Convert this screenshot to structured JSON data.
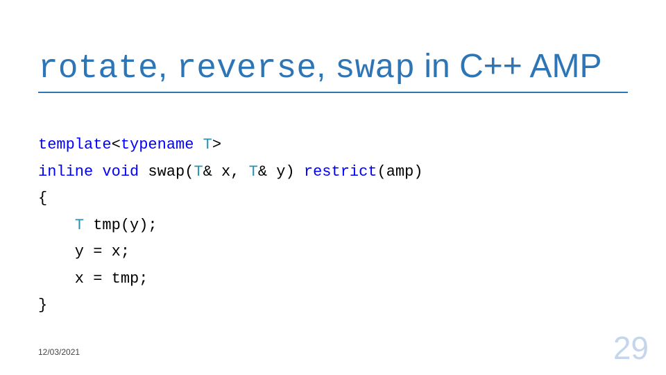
{
  "title": {
    "part1_mono": "rotate",
    "sep1": ", ",
    "part2_mono": "reverse",
    "sep2": ", ",
    "part3_mono": "swap",
    "tail": " in C++ AMP"
  },
  "code": {
    "l1": {
      "kw1": "template",
      "txt1": "<",
      "kw2": "typename",
      "txt2": " ",
      "tp1": "T",
      "txt3": ">"
    },
    "l2": {
      "kw1": "inline",
      "txt1": " ",
      "kw2": "void",
      "txt2": " swap(",
      "tp1": "T",
      "txt3": "& x, ",
      "tp2": "T",
      "txt4": "& y) ",
      "kw3": "restrict",
      "txt5": "(amp)"
    },
    "l3": {
      "txt1": "{"
    },
    "l4": {
      "txt1": "    ",
      "tp1": "T",
      "txt2": " tmp(y);"
    },
    "l5": {
      "txt1": "    y = x;"
    },
    "l6": {
      "txt1": "    x = tmp;"
    },
    "l7": {
      "txt1": "}"
    }
  },
  "footer": {
    "date": "12/03/2021",
    "page": "29"
  }
}
